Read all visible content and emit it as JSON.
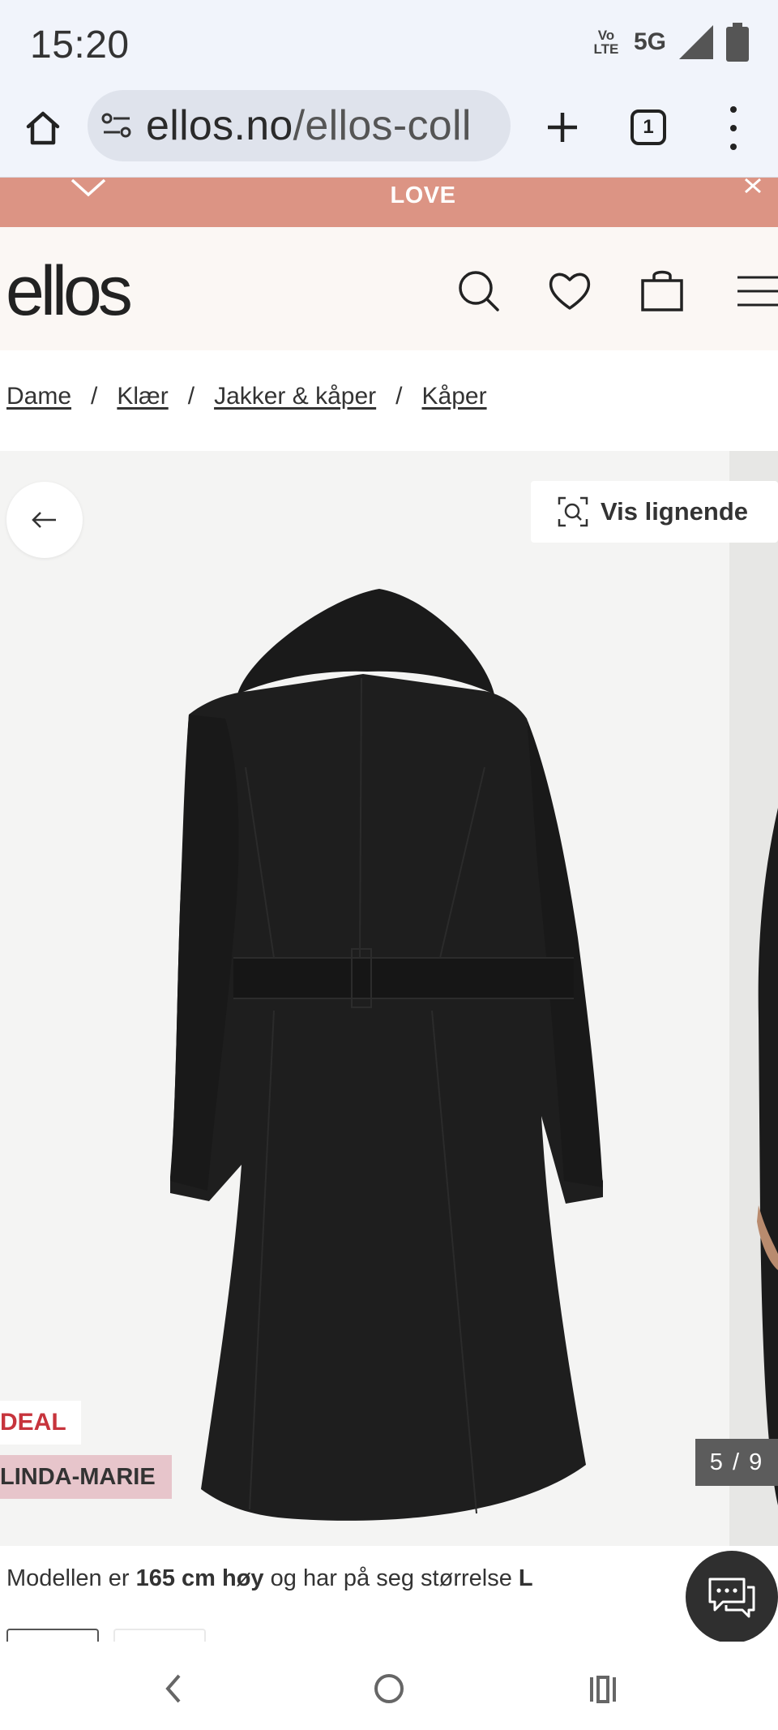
{
  "status_bar": {
    "time": "15:20",
    "volte_label": "Vo LTE",
    "network": "5G"
  },
  "browser": {
    "url_domain": "ellos.no",
    "url_path": "/ellos-coll",
    "tab_count": "1"
  },
  "promo": {
    "text": "LOVE"
  },
  "header": {
    "logo": "ellos"
  },
  "breadcrumb": [
    "Dame",
    "Klær",
    "Jakker & kåper",
    "Kåper"
  ],
  "gallery": {
    "similar_button": "Vis lignende",
    "badge_deal": "DEAL",
    "badge_brand": "LINDA-MARIE",
    "counter": "5 / 9"
  },
  "model_info": {
    "prefix": "Modellen er ",
    "height": "165 cm høy",
    "middle": " og har på seg størrelse ",
    "size": "L"
  },
  "colors": {
    "promo": "#dc9484",
    "header_bg": "#fbf7f4",
    "deal_text": "#c7343c",
    "brand_badge": "#e7c5cb",
    "coat": "#1e1e1e"
  }
}
